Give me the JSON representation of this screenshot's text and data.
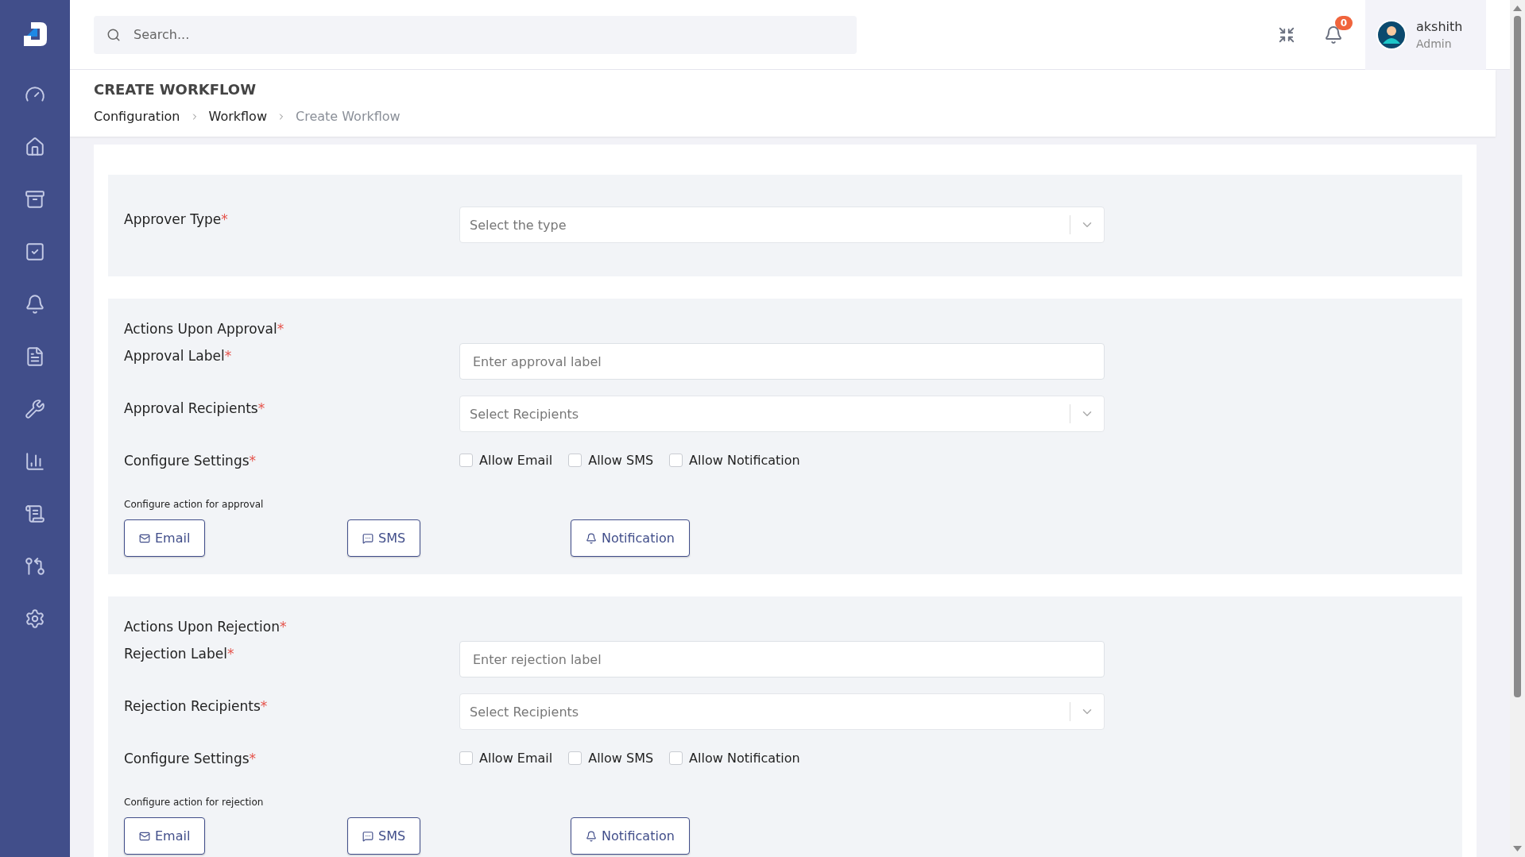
{
  "topbar": {
    "search": {
      "placeholder": "Search..."
    },
    "notifications": {
      "count": "0"
    },
    "user": {
      "name": "akshith",
      "role": "Admin"
    }
  },
  "header": {
    "title": "CREATE WORKFLOW",
    "breadcrumbs": [
      {
        "label": "Configuration",
        "current": false
      },
      {
        "label": "Workflow",
        "current": false
      },
      {
        "label": "Create Workflow",
        "current": true
      }
    ]
  },
  "sections": [
    {
      "rows": [
        {
          "kind": "select",
          "label": "Approver Type",
          "mark": "*",
          "placeholder": "Select the type"
        }
      ]
    },
    {
      "heading": {
        "label": "Actions Upon Approval",
        "mark": "*"
      },
      "rows": [
        {
          "kind": "input",
          "label": "Approval Label",
          "mark": "*",
          "placeholder": "Enter approval label"
        },
        {
          "kind": "select",
          "label": "Approval Recipients",
          "mark": "*",
          "placeholder": "Select Recipients"
        },
        {
          "kind": "checkboxes",
          "label": "Configure Settings",
          "mark": "*",
          "options": [
            {
              "label": "Allow Email",
              "checked": false
            },
            {
              "label": "Allow SMS",
              "checked": false
            },
            {
              "label": "Allow Notification",
              "checked": false
            }
          ]
        }
      ],
      "actions": {
        "caption": "Configure action for approval",
        "buttons": [
          {
            "kind": "email",
            "label": "Email"
          },
          {
            "kind": "sms",
            "label": "SMS"
          },
          {
            "kind": "notification",
            "label": "Notification"
          }
        ]
      }
    },
    {
      "heading": {
        "label": "Actions Upon Rejection",
        "mark": "*"
      },
      "rows": [
        {
          "kind": "input",
          "label": "Rejection Label",
          "mark": "*",
          "placeholder": "Enter rejection label"
        },
        {
          "kind": "select",
          "label": "Rejection Recipients",
          "mark": "*",
          "placeholder": "Select Recipients"
        },
        {
          "kind": "checkboxes",
          "label": "Configure Settings",
          "mark": "*",
          "options": [
            {
              "label": "Allow Email",
              "checked": false
            },
            {
              "label": "Allow SMS",
              "checked": false
            },
            {
              "label": "Allow Notification",
              "checked": false
            }
          ]
        }
      ],
      "actions": {
        "caption": "Configure action for rejection",
        "buttons": [
          {
            "kind": "email",
            "label": "Email"
          },
          {
            "kind": "sms",
            "label": "SMS"
          },
          {
            "kind": "notification",
            "label": "Notification"
          }
        ]
      }
    }
  ]
}
